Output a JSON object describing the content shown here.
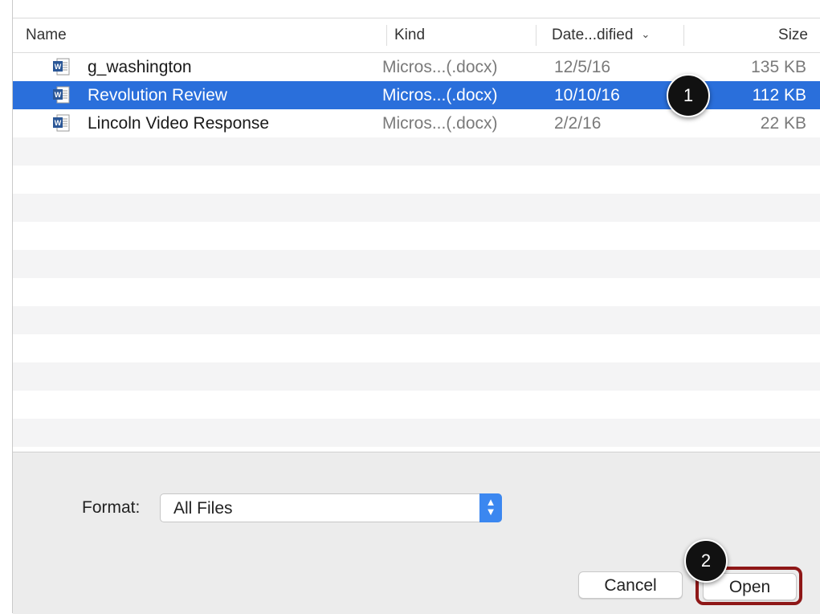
{
  "columns": {
    "name": "Name",
    "kind": "Kind",
    "date_modified": "Date...dified",
    "size": "Size"
  },
  "sort_indicator_icon": "chevron-down-icon",
  "files": [
    {
      "name": "g_washington",
      "kind": "Micros...(.docx)",
      "date": "12/5/16",
      "size": "135 KB",
      "icon": "word-document-icon",
      "selected": false
    },
    {
      "name": "Revolution Review",
      "kind": "Micros...(.docx)",
      "date": "10/10/16",
      "size": "112 KB",
      "icon": "word-document-icon",
      "selected": true
    },
    {
      "name": "Lincoln Video Response",
      "kind": "Micros...(.docx)",
      "date": "2/2/16",
      "size": "22 KB",
      "icon": "word-document-icon",
      "selected": false
    }
  ],
  "format": {
    "label": "Format:",
    "value": "All Files"
  },
  "buttons": {
    "cancel": "Cancel",
    "open": "Open"
  },
  "callouts": {
    "step1": "1",
    "step2": "2"
  },
  "colors": {
    "selection": "#2a6fdb",
    "highlight_outline": "#8e1717",
    "select_stepper": "#3b87f0"
  }
}
